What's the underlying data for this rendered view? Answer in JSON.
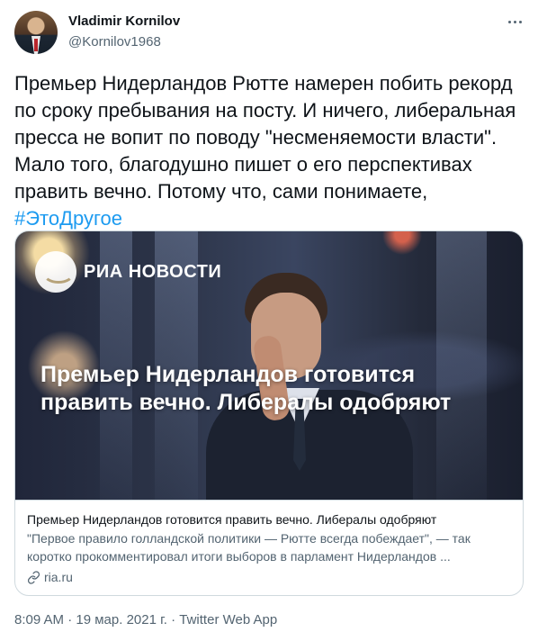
{
  "author": {
    "name": "Vladimir Kornilov",
    "handle": "@Kornilov1968"
  },
  "tweet": {
    "text": "Премьер Нидерландов Рютте намерен побить рекорд по сроку пребывания на посту. И ничего, либеральная пресса не вопит по поводу \"несменяемости власти\". Мало того, благодушно пишет о его перспективах править вечно. Потому что, сами понимаете,",
    "hashtag": "#ЭтоДругое"
  },
  "card": {
    "image": {
      "brand": "РИА НОВОСТИ",
      "headline": "Премьер Нидерландов готовится править вечно. Либералы одобряют"
    },
    "title": "Премьер Нидерландов готовится править вечно. Либералы одобряют",
    "description": "\"Первое правило голландской политики — Рютте всегда побеждает\", — так коротко прокомментировал итоги выборов в парламент Нидерландов ...",
    "domain": "ria.ru"
  },
  "meta": {
    "time": "8:09 AM",
    "separator1": " · ",
    "date": "19 мар. 2021 г.",
    "separator2": " · ",
    "source": "Twitter Web App"
  },
  "icons": {
    "more": "more-icon",
    "link": "link-icon"
  },
  "colors": {
    "accent": "#1d9bf0",
    "text": "#0f1419",
    "secondary": "#536471",
    "border": "#cfd9de"
  }
}
